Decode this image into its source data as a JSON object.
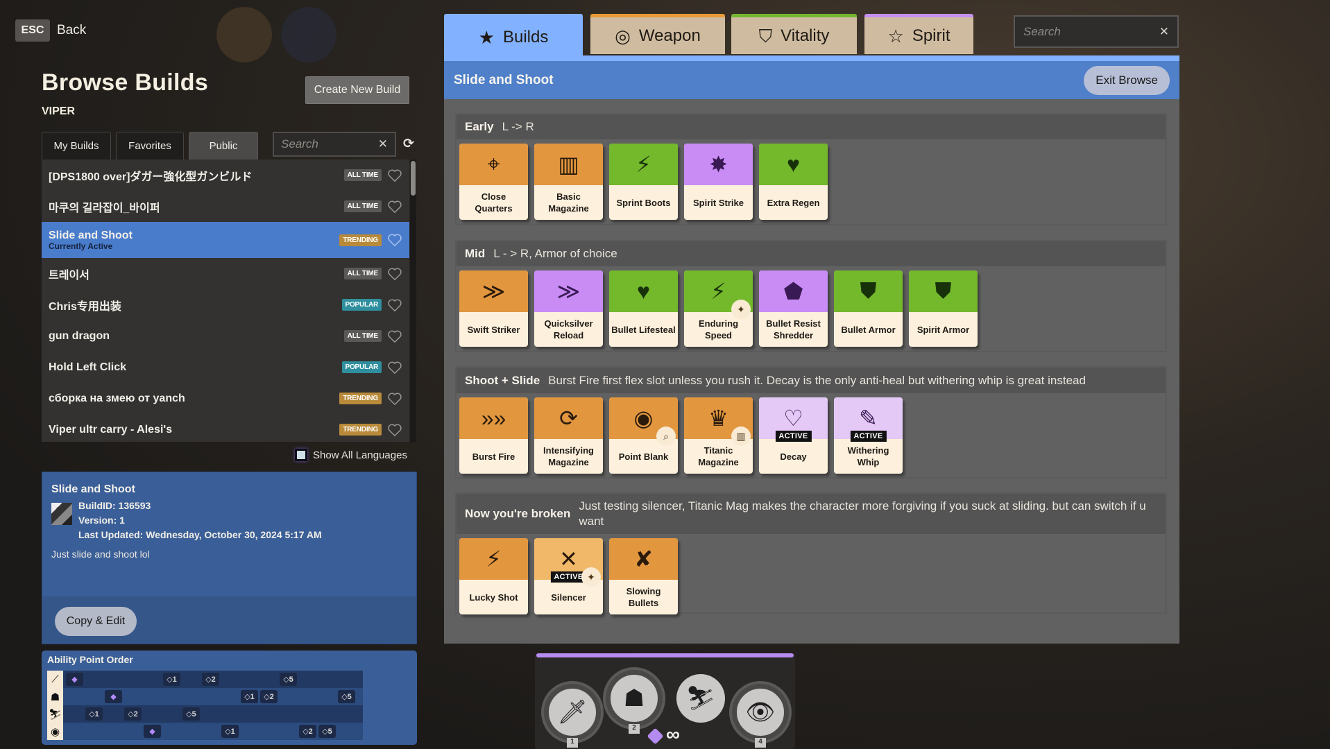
{
  "nav": {
    "esc_key": "ESC",
    "back_label": "Back"
  },
  "page": {
    "title": "Browse Builds",
    "hero": "VIPER",
    "create_button": "Create New Build"
  },
  "list_tabs": [
    {
      "label": "My Builds",
      "active": false
    },
    {
      "label": "Favorites",
      "active": false
    },
    {
      "label": "Public",
      "active": true
    }
  ],
  "list_search": {
    "placeholder": "Search",
    "value": ""
  },
  "builds": [
    {
      "name": "[DPS1800 over]ダガー強化型ガンビルド",
      "badge": "ALL TIME",
      "badge_type": "alltime"
    },
    {
      "name": "마쿠의 길라잡이_바이퍼",
      "badge": "ALL TIME",
      "badge_type": "alltime"
    },
    {
      "name": "Slide and Shoot",
      "sub": "Currently Active",
      "badge": "TRENDING",
      "badge_type": "trending",
      "selected": true
    },
    {
      "name": "트레이서",
      "badge": "ALL TIME",
      "badge_type": "alltime"
    },
    {
      "name": "Chris专用出装",
      "badge": "POPULAR",
      "badge_type": "popular"
    },
    {
      "name": "gun dragon",
      "badge": "ALL TIME",
      "badge_type": "alltime"
    },
    {
      "name": "Hold Left Click",
      "badge": "POPULAR",
      "badge_type": "popular"
    },
    {
      "name": "сборка на змею от yanch",
      "badge": "TRENDING",
      "badge_type": "trending"
    },
    {
      "name": "Viper ultr carry - Alesi's",
      "badge": "TRENDING",
      "badge_type": "trending"
    }
  ],
  "show_all_languages": {
    "label": "Show All Languages",
    "checked": false
  },
  "detail": {
    "title": "Slide and Shoot",
    "build_id": "BuildID: 136593",
    "version": "Version: 1",
    "last_updated": "Last Updated: Wednesday, October 30, 2024 5:17 AM",
    "description": "Just slide and shoot lol",
    "copy_button": "Copy & Edit"
  },
  "ability_order": {
    "title": "Ability Point Order",
    "abilities": [
      "ability-1-dagger",
      "ability-2-shade",
      "ability-3-slide",
      "ability-4-eye"
    ],
    "steps": [
      {
        "step": 1,
        "ability": 1,
        "label": "◆"
      },
      {
        "step": 2,
        "ability": 3,
        "label": "◇1"
      },
      {
        "step": 3,
        "ability": 2,
        "label": "◆"
      },
      {
        "step": 4,
        "ability": 3,
        "label": "◇2"
      },
      {
        "step": 5,
        "ability": 4,
        "label": "◆"
      },
      {
        "step": 6,
        "ability": 1,
        "label": "◇1"
      },
      {
        "step": 7,
        "ability": 3,
        "label": "◇5"
      },
      {
        "step": 8,
        "ability": 1,
        "label": "◇2"
      },
      {
        "step": 9,
        "ability": 4,
        "label": "◇1"
      },
      {
        "step": 10,
        "ability": 2,
        "label": "◇1"
      },
      {
        "step": 11,
        "ability": 2,
        "label": "◇2"
      },
      {
        "step": 12,
        "ability": 1,
        "label": "◇5"
      },
      {
        "step": 13,
        "ability": 4,
        "label": "◇2"
      },
      {
        "step": 14,
        "ability": 4,
        "label": "◇5"
      },
      {
        "step": 15,
        "ability": 2,
        "label": "◇5"
      }
    ]
  },
  "main_tabs": [
    {
      "label": "Builds",
      "icon": "star-icon",
      "glyph": "★",
      "active": true
    },
    {
      "label": "Weapon",
      "icon": "weapon-ring-icon",
      "glyph": "◎",
      "accent": "#e89a35"
    },
    {
      "label": "Vitality",
      "icon": "shield-heart-icon",
      "glyph": "⛉",
      "accent": "#72b530"
    },
    {
      "label": "Spirit",
      "icon": "spirit-star-icon",
      "glyph": "☆",
      "accent": "#c58ff0"
    }
  ],
  "shop_search": {
    "placeholder": "Search",
    "value": ""
  },
  "panel": {
    "title": "Slide and Shoot",
    "exit_button": "Exit Browse"
  },
  "sections": [
    {
      "name": "Early",
      "note": "L -> R",
      "items": [
        {
          "name": "Close Quarters",
          "category": "weapon",
          "glyph": "⌖"
        },
        {
          "name": "Basic Magazine",
          "category": "weapon",
          "glyph": "▥"
        },
        {
          "name": "Sprint Boots",
          "category": "vitality",
          "glyph": "⚡"
        },
        {
          "name": "Spirit Strike",
          "category": "spirit",
          "glyph": "✸"
        },
        {
          "name": "Extra Regen",
          "category": "vitality",
          "glyph": "♥"
        }
      ]
    },
    {
      "name": "Mid",
      "note": "L - > R, Armor of choice",
      "items": [
        {
          "name": "Swift Striker",
          "category": "weapon",
          "glyph": "≫"
        },
        {
          "name": "Quicksilver Reload",
          "category": "spirit",
          "glyph": "≫"
        },
        {
          "name": "Bullet Lifesteal",
          "category": "vitality",
          "glyph": "♥"
        },
        {
          "name": "Enduring Speed",
          "category": "vitality",
          "glyph": "⚡",
          "mini": "✦"
        },
        {
          "name": "Bullet Resist Shredder",
          "category": "spirit",
          "glyph": "⬟"
        },
        {
          "name": "Bullet Armor",
          "category": "vitality",
          "glyph": "⛊"
        },
        {
          "name": "Spirit Armor",
          "category": "vitality",
          "glyph": "⛊"
        }
      ]
    },
    {
      "name": "Shoot + Slide",
      "note": "Burst Fire first flex slot unless you rush it. Decay is the only anti-heal but withering whip is great instead",
      "items": [
        {
          "name": "Burst Fire",
          "category": "weapon",
          "glyph": "»»"
        },
        {
          "name": "Intensifying Magazine",
          "category": "weapon",
          "glyph": "⟳"
        },
        {
          "name": "Point Blank",
          "category": "weapon",
          "glyph": "◉",
          "mini": "⌕"
        },
        {
          "name": "Titanic Magazine",
          "category": "weapon",
          "glyph": "♛",
          "mini": "▥"
        },
        {
          "name": "Decay",
          "category": "spirit-light",
          "glyph": "♡",
          "active": "ACTIVE"
        },
        {
          "name": "Withering Whip",
          "category": "spirit-light",
          "glyph": "✎",
          "active": "ACTIVE"
        }
      ]
    },
    {
      "name": "Now you're broken",
      "note": "Just testing silencer, Titanic Mag makes the character more forgiving if you suck at sliding. but can switch if u want",
      "items": [
        {
          "name": "Lucky Shot",
          "category": "weapon",
          "glyph": "⚡"
        },
        {
          "name": "Silencer",
          "category": "weapon-light",
          "glyph": "✕",
          "active": "ACTIVE",
          "mini": "✦"
        },
        {
          "name": "Slowing Bullets",
          "category": "weapon",
          "glyph": "✘"
        }
      ]
    }
  ],
  "ability_bar": {
    "abilities": [
      {
        "name": "ability-1-dagger",
        "glyph": "🗡",
        "key": "1"
      },
      {
        "name": "ability-2-shade",
        "glyph": "☗",
        "key": "2"
      },
      {
        "name": "ability-3-slide",
        "glyph": "⛷",
        "key": ""
      },
      {
        "name": "ability-4-eye",
        "glyph": "👁",
        "key": "4"
      }
    ],
    "ability_points": "∞"
  }
}
